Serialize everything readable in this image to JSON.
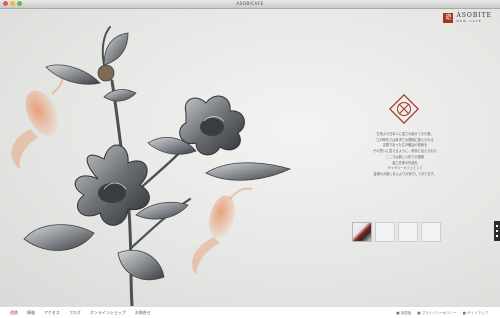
{
  "window": {
    "title": "ASOBICAFE"
  },
  "brand": {
    "mark": "遊",
    "name": "ASOBITE",
    "sub": "NEW CAFE"
  },
  "intro": {
    "lines": [
      "古来より日本人に愛され続けてきた鉄。",
      "江戸時代では東洋三大発明に数えられる",
      "名物であった江戸鍛冶の技術を",
      "その思いに答えるように、現代に伝えられた",
      "ここでは新しい形での提案",
      "金工作家の作品を",
      "ギャラリーカフェとして",
      "皆様のお越しを心よりお待ちしております。"
    ]
  },
  "thumbs": [
    {
      "name": "thumb-1"
    },
    {
      "name": "thumb-2"
    },
    {
      "name": "thumb-3"
    },
    {
      "name": "thumb-4"
    }
  ],
  "nav": [
    "遊鉄",
    "情報",
    "アクセス",
    "ブログ",
    "オンラインショップ",
    "お問合せ"
  ],
  "footer_links": [
    "■ 英語版",
    "■ プライバシーポリシー",
    "■ サイトマップ"
  ],
  "colors": {
    "accent": "#a3341f",
    "goldfish": "#e8956a",
    "metal": "#5c6064"
  }
}
